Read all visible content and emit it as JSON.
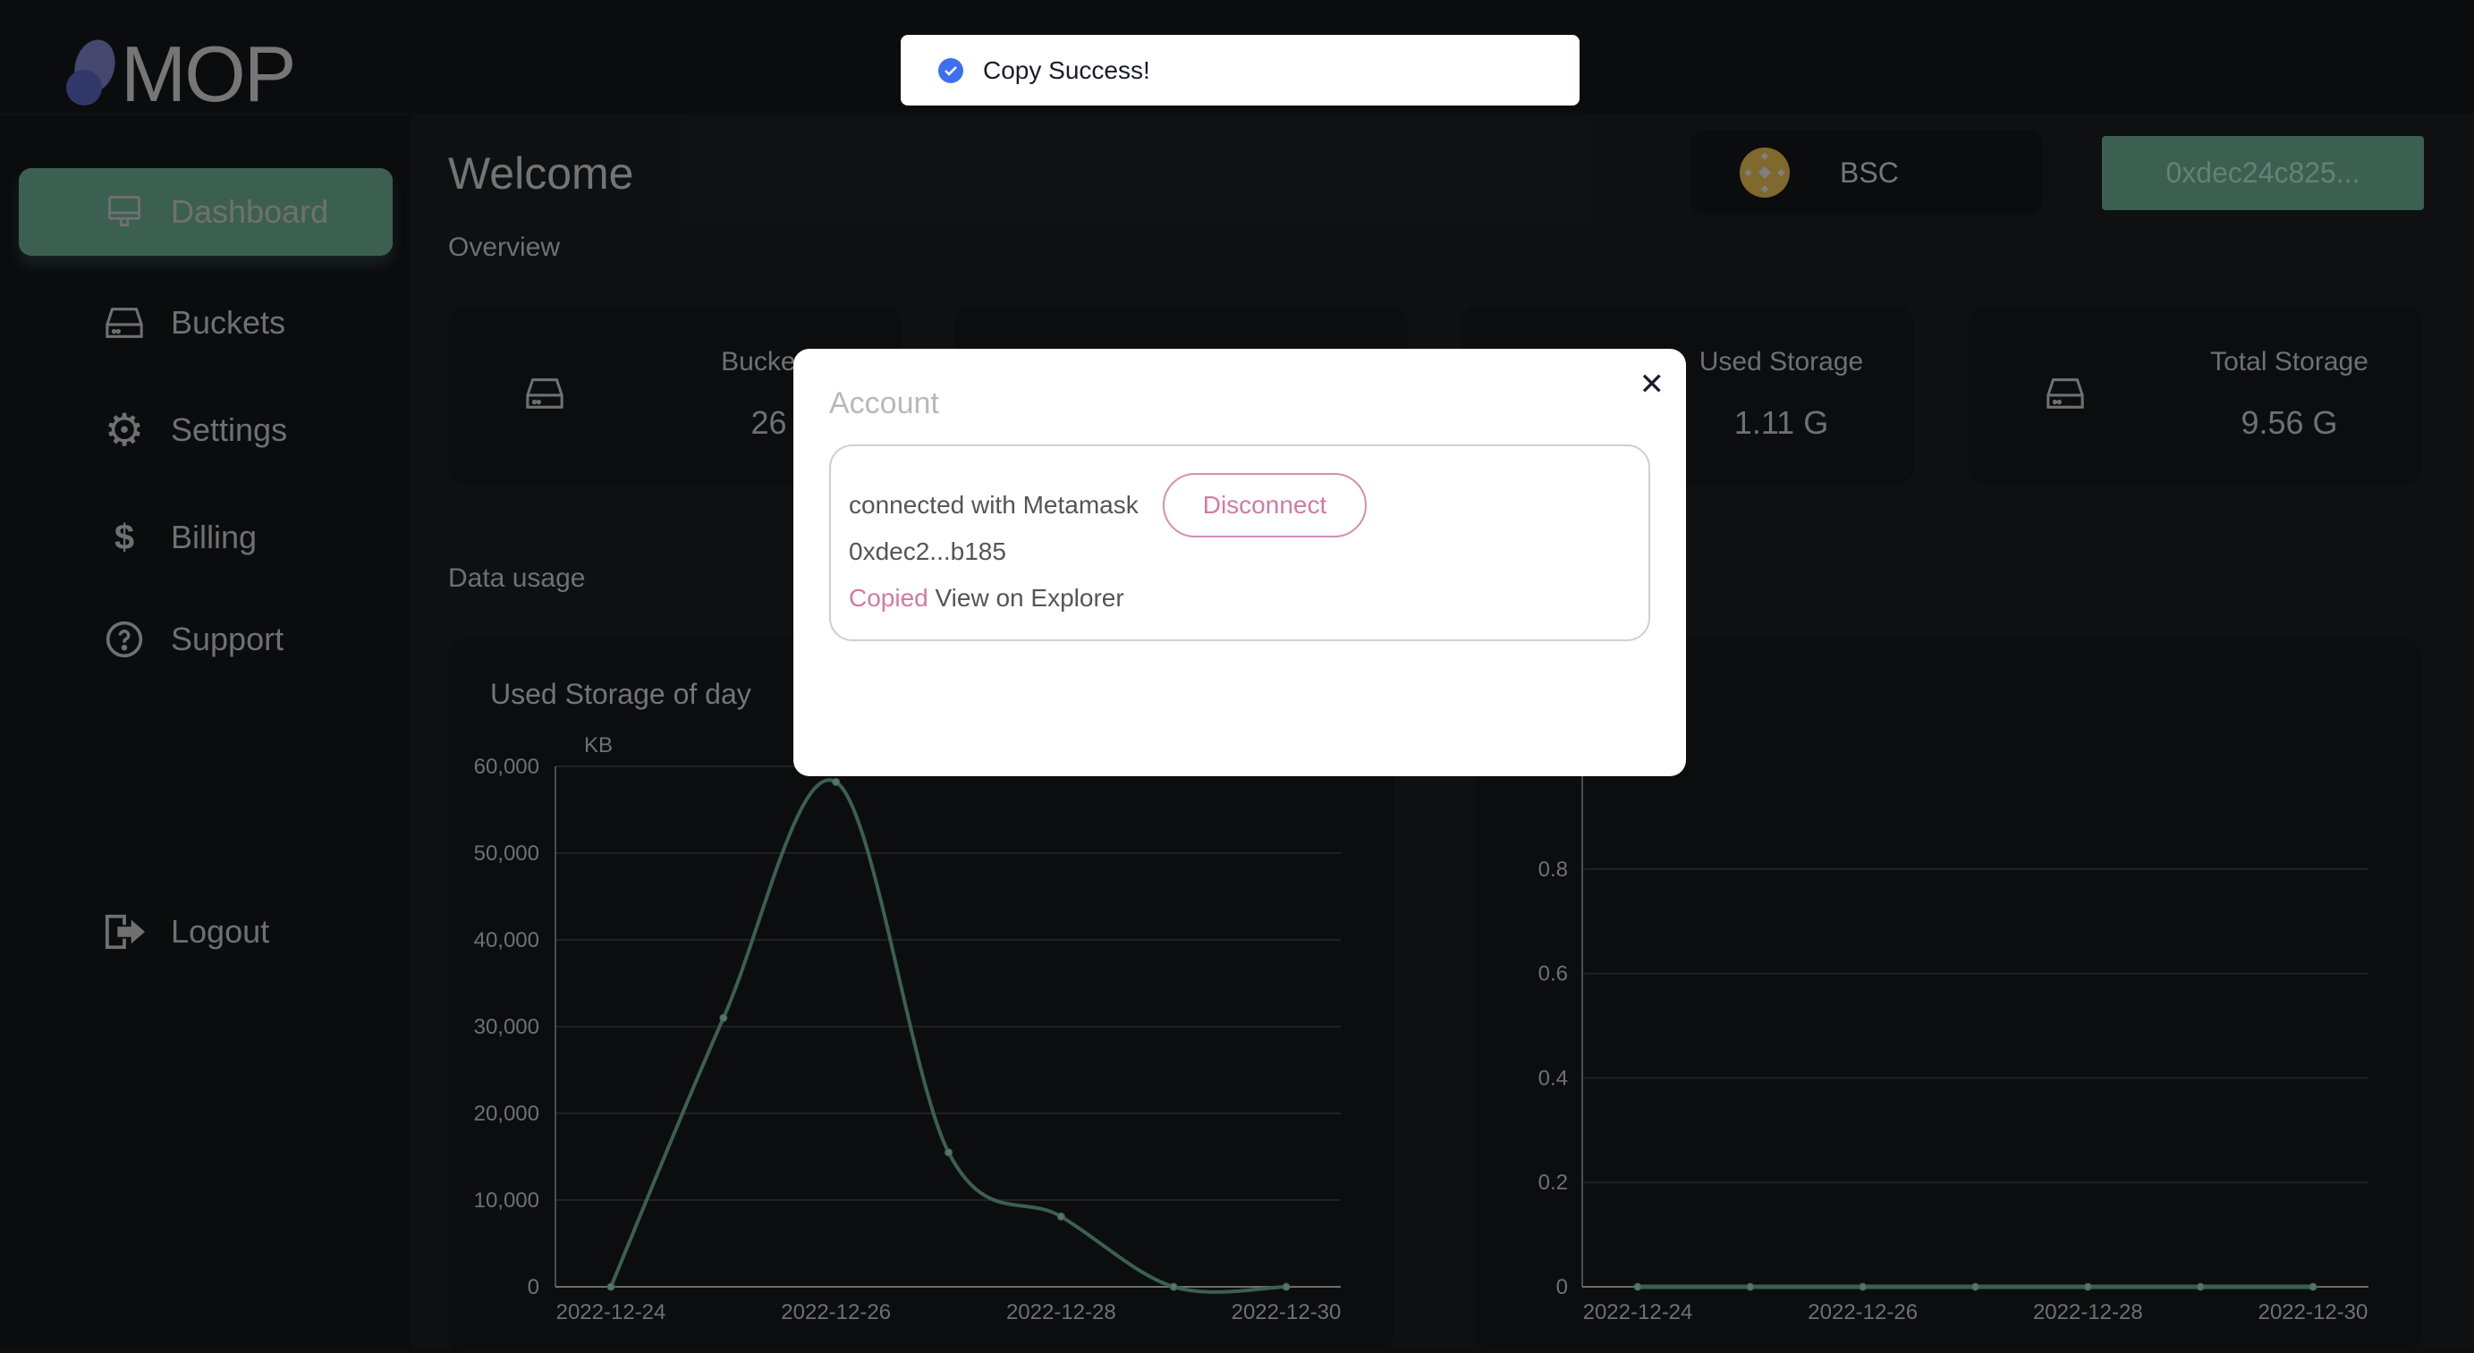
{
  "app": {
    "logo": "MOP"
  },
  "sidebar": {
    "items": [
      {
        "label": "Dashboard",
        "icon": "monitor-icon",
        "active": true
      },
      {
        "label": "Buckets",
        "icon": "drive-icon"
      },
      {
        "label": "Settings",
        "icon": "gear-icon"
      },
      {
        "label": "Billing",
        "icon": "dollar-icon"
      },
      {
        "label": "Support",
        "icon": "question-circle-icon"
      },
      {
        "label": "Logout",
        "icon": "logout-icon"
      }
    ]
  },
  "header": {
    "title": "Welcome",
    "network": "BSC",
    "address": "0xdec24c825..."
  },
  "overview": {
    "heading": "Overview",
    "cards": [
      {
        "label": "Buckets",
        "value": "26"
      },
      {
        "label": "",
        "value": ""
      },
      {
        "label": "Used Storage",
        "value": "1.11 G"
      },
      {
        "label": "Total Storage",
        "value": "9.56 G"
      }
    ]
  },
  "data_usage": {
    "heading": "Data usage"
  },
  "colors": {
    "accent": "#41695a",
    "pink": "#d17aa8",
    "toast_icon": "#3f6ff0",
    "bnb": "#8a7230"
  },
  "chart_data": [
    {
      "type": "line",
      "title": "Used Storage of day",
      "ylabel": "KB",
      "x": [
        "2022-12-24",
        "2022-12-25",
        "2022-12-26",
        "2022-12-27",
        "2022-12-28",
        "2022-12-29",
        "2022-12-30"
      ],
      "xtick_labels": [
        "2022-12-24",
        "2022-12-26",
        "2022-12-28",
        "2022-12-30"
      ],
      "y": [
        0,
        31000,
        58200,
        15500,
        8100,
        0,
        0
      ],
      "ylim": [
        0,
        60000
      ],
      "ytick_labels": [
        "0",
        "10,000",
        "20,000",
        "30,000",
        "40,000",
        "50,000",
        "60,000"
      ],
      "grid": true,
      "smooth": true
    },
    {
      "type": "line",
      "x": [
        "2022-12-24",
        "2022-12-25",
        "2022-12-26",
        "2022-12-27",
        "2022-12-28",
        "2022-12-29",
        "2022-12-30"
      ],
      "xtick_labels": [
        "2022-12-24",
        "2022-12-26",
        "2022-12-28",
        "2022-12-30"
      ],
      "y": [
        0,
        0,
        0,
        0,
        0,
        0,
        0
      ],
      "ylim": [
        0,
        1
      ],
      "ytick_labels": [
        "0",
        "0.2",
        "0.4",
        "0.6",
        "0.8"
      ],
      "grid": true
    }
  ],
  "modal": {
    "title": "Account",
    "connected_text": "connected with Metamask",
    "disconnect": "Disconnect",
    "address": "0xdec2...b185",
    "copied": "Copied",
    "explorer": "View on Explorer"
  },
  "toast": {
    "message": "Copy Success!"
  }
}
